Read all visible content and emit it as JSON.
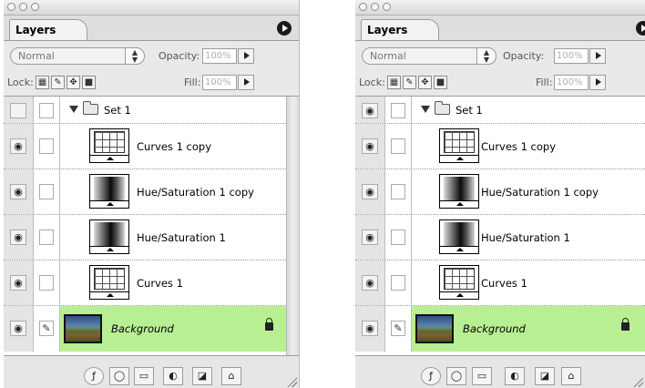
{
  "palettes": [
    {
      "tab_label": "Layers",
      "blend_mode": "Normal",
      "opacity_label": "Opacity:",
      "opacity_value": "100%",
      "lock_label": "Lock:",
      "fill_label": "Fill:",
      "fill_value": "100%",
      "layers": [
        {
          "name": "Set 1",
          "type": "group",
          "visible": false
        },
        {
          "name": "Curves 1 copy",
          "type": "curves",
          "visible": true
        },
        {
          "name": "Hue/Saturation 1 copy",
          "type": "hue",
          "visible": true
        },
        {
          "name": "Hue/Saturation 1",
          "type": "hue",
          "visible": true
        },
        {
          "name": "Curves 1",
          "type": "curves",
          "visible": true
        },
        {
          "name": "Background",
          "type": "background",
          "visible": true,
          "selected": true,
          "locked": true
        }
      ]
    },
    {
      "tab_label": "Layers",
      "blend_mode": "Normal",
      "opacity_label": "Opacity:",
      "opacity_value": "100%",
      "lock_label": "Lock:",
      "fill_label": "Fill:",
      "fill_value": "100%",
      "layers": [
        {
          "name": "Set 1",
          "type": "group",
          "visible": true
        },
        {
          "name": "Curves 1 copy",
          "type": "curves",
          "visible": true
        },
        {
          "name": "Hue/Saturation 1 copy",
          "type": "hue",
          "visible": true
        },
        {
          "name": "Hue/Saturation 1",
          "type": "hue",
          "visible": true
        },
        {
          "name": "Curves 1",
          "type": "curves",
          "visible": true
        },
        {
          "name": "Background",
          "type": "background",
          "visible": true,
          "selected": true,
          "locked": true
        }
      ]
    }
  ],
  "icons": {
    "eye": "eye-icon",
    "brush": "brush-icon",
    "lock": "lock-icon",
    "folder": "folder-icon"
  },
  "colors": {
    "selected_layer": "#b8ef93",
    "panel_bg": "#e9e9e9"
  }
}
